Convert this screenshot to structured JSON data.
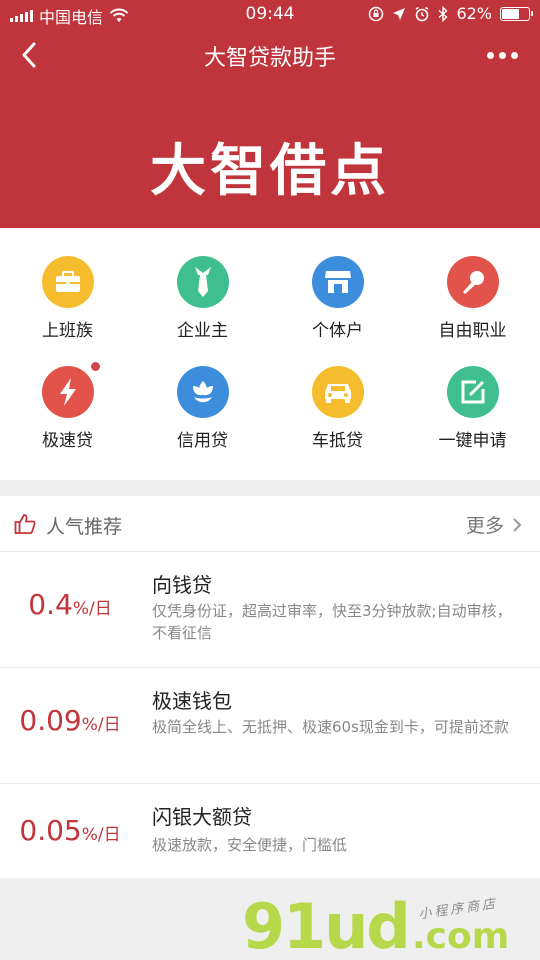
{
  "status_bar": {
    "carrier": "中国电信",
    "time": "09:44",
    "battery": "62%",
    "battery_level": 0.62
  },
  "nav": {
    "title": "大智贷款助手"
  },
  "banner": {
    "brand": "大智借点"
  },
  "categories": [
    {
      "label": "上班族",
      "icon": "briefcase-icon",
      "color": "#f5bd2e"
    },
    {
      "label": "企业主",
      "icon": "tie-icon",
      "color": "#3fbf8f"
    },
    {
      "label": "个体户",
      "icon": "shop-icon",
      "color": "#3d8ddd"
    },
    {
      "label": "自由职业",
      "icon": "microphone-icon",
      "color": "#e2534b"
    },
    {
      "label": "极速贷",
      "icon": "lightning-icon",
      "color": "#e2534b"
    },
    {
      "label": "信用贷",
      "icon": "flower-icon",
      "color": "#3d8ddd"
    },
    {
      "label": "车抵贷",
      "icon": "car-icon",
      "color": "#f5bd2e"
    },
    {
      "label": "一键申请",
      "icon": "edit-icon",
      "color": "#3fbf8f"
    }
  ],
  "recommend": {
    "title": "人气推荐",
    "more": "更多",
    "items": [
      {
        "rate": "0.4",
        "unit": "%/日",
        "name": "向钱贷",
        "desc": "仅凭身份证，超高过审率，快至3分钟放款;自动审核，不看征信"
      },
      {
        "rate": "0.09",
        "unit": "%/日",
        "name": "极速钱包",
        "desc": "极简全线上、无抵押、极速60s现金到卡，可提前还款"
      },
      {
        "rate": "0.05",
        "unit": "%/日",
        "name": "闪银大额贷",
        "desc": "极速放款，安全便捷，门槛低"
      }
    ]
  },
  "watermark": {
    "main": "91ud",
    "domain": ".com",
    "caption": "小程序商店"
  }
}
